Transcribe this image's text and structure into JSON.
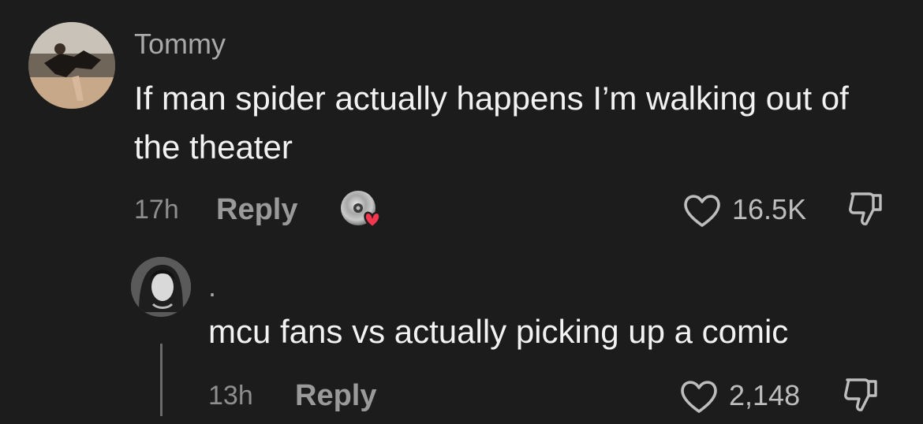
{
  "comments": [
    {
      "username": "Tommy",
      "text": "If man spider actually happens I’m walking out of the theater",
      "time": "17h",
      "reply_label": "Reply",
      "likes": "16.5K",
      "badge_icon": "disc-heart-icon"
    },
    {
      "username": ".",
      "text": "mcu fans vs actually picking up a comic",
      "time": "13h",
      "reply_label": "Reply",
      "likes": "2,148"
    }
  ],
  "icons": {
    "like": "heart-outline-icon",
    "dislike": "thumbs-down-icon"
  },
  "colors": {
    "background": "#1c1c1c",
    "username": "#a9a9a9",
    "text": "#f2f2f2",
    "muted": "#8e8e8e",
    "accent_heart": "#f2384f"
  }
}
